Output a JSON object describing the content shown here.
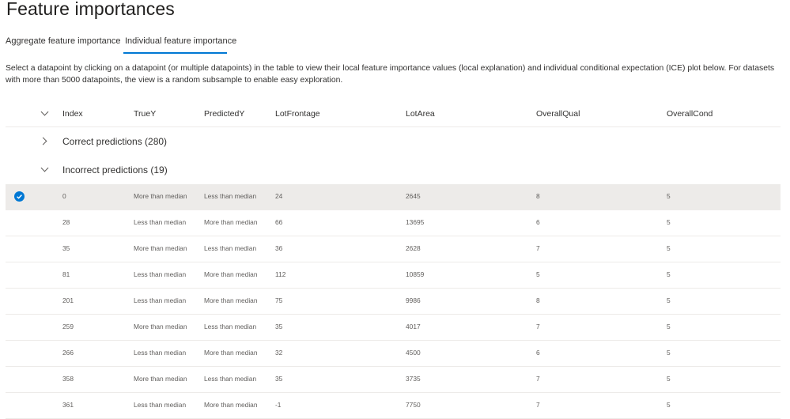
{
  "page": {
    "title": "Feature importances"
  },
  "tabs": [
    {
      "label": "Aggregate feature importance",
      "selected": false
    },
    {
      "label": "Individual feature importance",
      "selected": true
    }
  ],
  "description": "Select a datapoint by clicking on a datapoint (or multiple datapoints) in the table to view their local feature importance values (local explanation) and individual conditional expectation (ICE) plot below. For datasets with more than 5000 datapoints, the view is a random subsample to enable easy exploration.",
  "table": {
    "columns": [
      "Index",
      "TrueY",
      "PredictedY",
      "LotFrontage",
      "LotArea",
      "OverallQual",
      "OverallCond"
    ],
    "groups": [
      {
        "label": "Correct predictions (280)",
        "expanded": false
      },
      {
        "label": "Incorrect predictions (19)",
        "expanded": true
      }
    ],
    "rows": [
      {
        "index": "0",
        "truey": "More than median",
        "predictedy": "Less than median",
        "lotfrontage": "24",
        "lotarea": "2645",
        "overallqual": "8",
        "overallcond": "5",
        "selected": true
      },
      {
        "index": "28",
        "truey": "Less than median",
        "predictedy": "More than median",
        "lotfrontage": "66",
        "lotarea": "13695",
        "overallqual": "6",
        "overallcond": "5",
        "selected": false
      },
      {
        "index": "35",
        "truey": "More than median",
        "predictedy": "Less than median",
        "lotfrontage": "36",
        "lotarea": "2628",
        "overallqual": "7",
        "overallcond": "5",
        "selected": false
      },
      {
        "index": "81",
        "truey": "Less than median",
        "predictedy": "More than median",
        "lotfrontage": "112",
        "lotarea": "10859",
        "overallqual": "5",
        "overallcond": "5",
        "selected": false
      },
      {
        "index": "201",
        "truey": "Less than median",
        "predictedy": "More than median",
        "lotfrontage": "75",
        "lotarea": "9986",
        "overallqual": "8",
        "overallcond": "5",
        "selected": false
      },
      {
        "index": "259",
        "truey": "More than median",
        "predictedy": "Less than median",
        "lotfrontage": "35",
        "lotarea": "4017",
        "overallqual": "7",
        "overallcond": "5",
        "selected": false
      },
      {
        "index": "266",
        "truey": "Less than median",
        "predictedy": "More than median",
        "lotfrontage": "32",
        "lotarea": "4500",
        "overallqual": "6",
        "overallcond": "5",
        "selected": false
      },
      {
        "index": "358",
        "truey": "More than median",
        "predictedy": "Less than median",
        "lotfrontage": "35",
        "lotarea": "3735",
        "overallqual": "7",
        "overallcond": "5",
        "selected": false
      },
      {
        "index": "361",
        "truey": "Less than median",
        "predictedy": "More than median",
        "lotfrontage": "-1",
        "lotarea": "7750",
        "overallqual": "7",
        "overallcond": "5",
        "selected": false
      }
    ]
  },
  "icons": {
    "expand_all": "chevron-down-icon",
    "group_collapsed": "chevron-right-icon",
    "group_expanded": "chevron-down-icon",
    "row_selected": "checkmark-circle-icon"
  },
  "colors": {
    "accent": "#0078d4",
    "selected_row": "#edebe9"
  }
}
